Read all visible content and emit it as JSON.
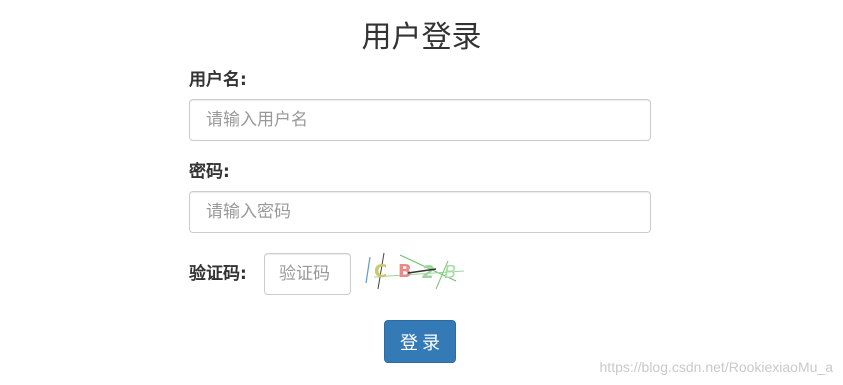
{
  "page": {
    "title": "用户登录"
  },
  "form": {
    "username": {
      "label": "用户名:",
      "placeholder": "请输入用户名",
      "value": ""
    },
    "password": {
      "label": "密码:",
      "placeholder": "请输入密码",
      "value": ""
    },
    "captcha": {
      "label": "验证码:",
      "placeholder": "验证码",
      "value": "",
      "image_text": "CB2B"
    },
    "submit_label": "登录"
  },
  "watermark": "https://blog.csdn.net/RookiexiaoMu_a",
  "colors": {
    "primary": "#337ab7",
    "text": "#333333",
    "border": "#cccccc",
    "placeholder": "#999999"
  }
}
